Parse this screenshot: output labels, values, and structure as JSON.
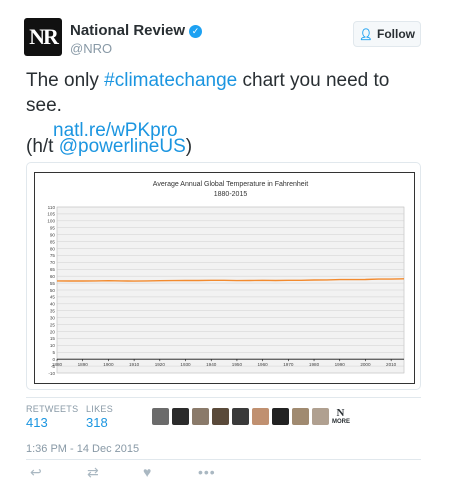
{
  "account": {
    "avatar_text": "NR",
    "name": "National Review",
    "handle": "@NRO",
    "follow_label": "Follow"
  },
  "tweet": {
    "text_before": "The only ",
    "hashtag": "#climatechange",
    "text_after": " chart you need to see.",
    "link": "natl.re/wPKpro",
    "hat_tip_prefix": "(h/t ",
    "mention": "@powerlineUS",
    "hat_tip_suffix": ")"
  },
  "chart_data": {
    "type": "line",
    "title": "Average Annual Global Temperature in Fahrenheit",
    "subtitle": "1880-2015",
    "xlabel": "",
    "ylabel": "",
    "xlim": [
      1880,
      2015
    ],
    "ylim": [
      -10,
      110
    ],
    "x_ticks": [
      1880,
      1890,
      1900,
      1910,
      1920,
      1930,
      1940,
      1950,
      1960,
      1970,
      1980,
      1990,
      2000,
      2010
    ],
    "y_ticks": [
      -10,
      -5,
      0,
      5,
      10,
      15,
      20,
      25,
      30,
      35,
      40,
      45,
      50,
      55,
      60,
      65,
      70,
      75,
      80,
      85,
      90,
      95,
      100,
      105,
      110
    ],
    "grid": true,
    "series_color": "#f28a2e",
    "x": [
      1880,
      1885,
      1890,
      1895,
      1900,
      1905,
      1910,
      1915,
      1920,
      1925,
      1930,
      1935,
      1940,
      1945,
      1950,
      1955,
      1960,
      1965,
      1970,
      1975,
      1980,
      1985,
      1990,
      1995,
      2000,
      2005,
      2010,
      2015
    ],
    "values": [
      56.6,
      56.5,
      56.5,
      56.6,
      56.7,
      56.6,
      56.4,
      56.6,
      56.7,
      56.8,
      56.9,
      56.9,
      57.0,
      57.0,
      56.8,
      56.9,
      57.0,
      56.9,
      57.0,
      57.0,
      57.2,
      57.3,
      57.5,
      57.5,
      57.6,
      57.9,
      57.9,
      58.1
    ]
  },
  "stats": {
    "retweets_label": "RETWEETS",
    "retweets": "413",
    "likes_label": "LIKES",
    "likes": "318",
    "more_label": "MORE"
  },
  "face_colors": [
    "#6b6b6b",
    "#2b2b2b",
    "#8a7a6a",
    "#5a4a3a",
    "#3a3a3a",
    "#c09070",
    "#222222",
    "#a08a70",
    "#b0a090"
  ],
  "timestamp": "1:36 PM - 14 Dec 2015"
}
